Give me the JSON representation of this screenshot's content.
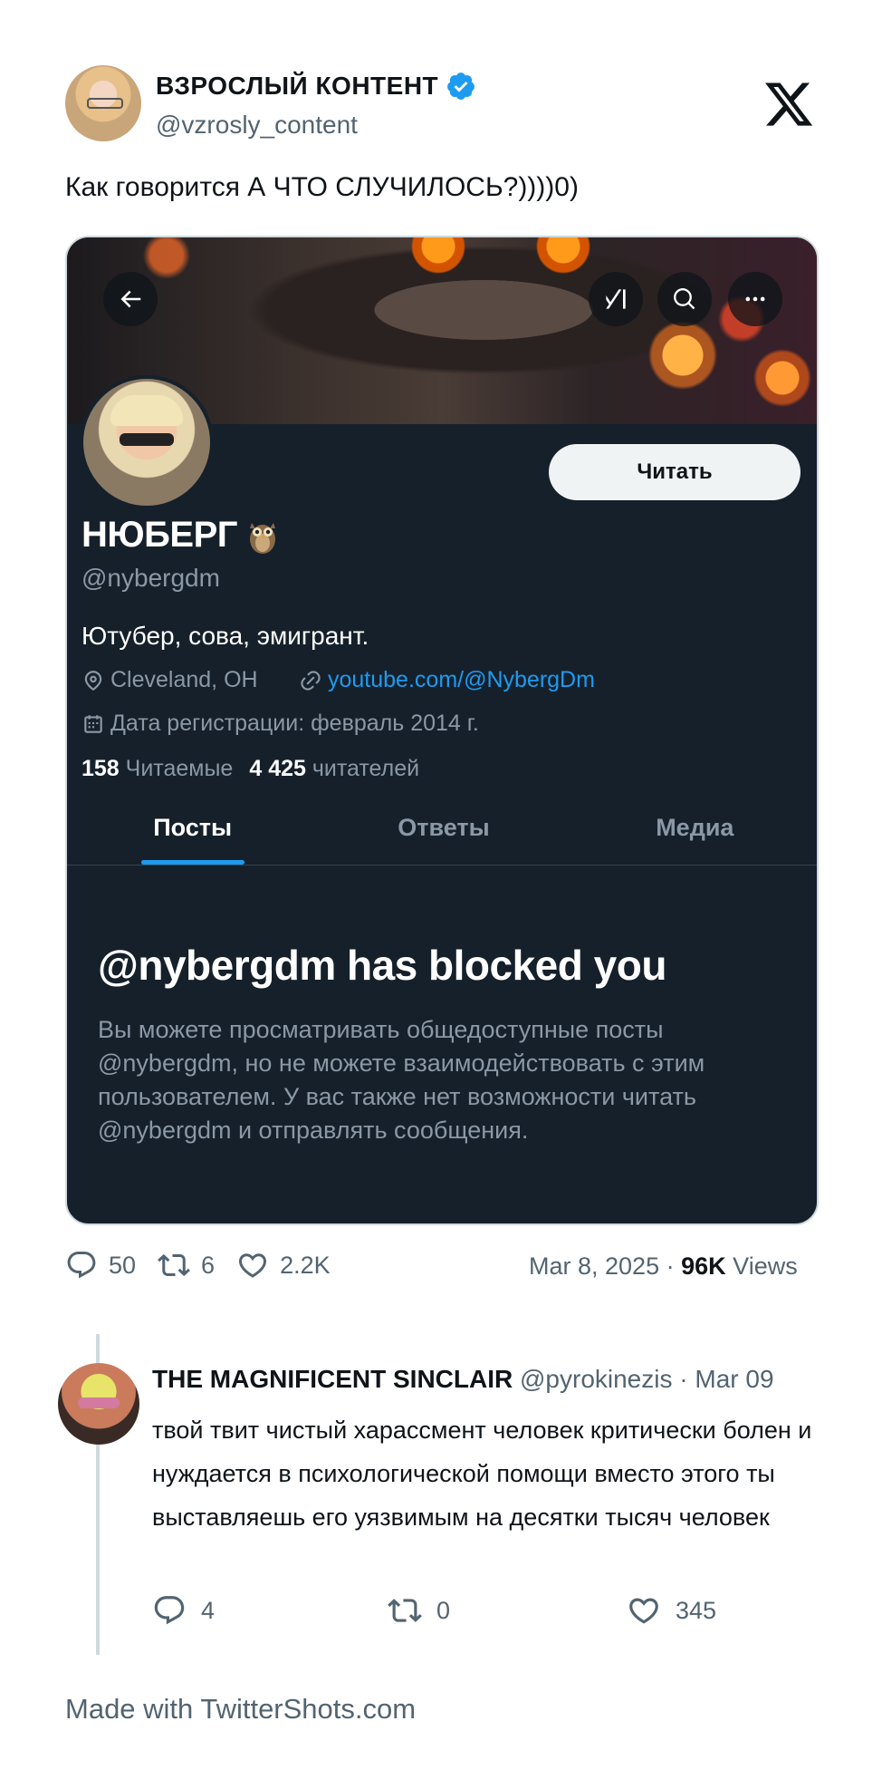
{
  "author": {
    "name": "ВЗРОСЛЫЙ КОНТЕНТ",
    "handle": "@vzrosly_content",
    "verified": true
  },
  "tweet": {
    "text": "Как говорится А ЧТО СЛУЧИЛОСЬ?))))0)",
    "replies": "50",
    "retweets": "6",
    "likes": "2.2K",
    "date": "Mar 8, 2025",
    "separator": "·",
    "views_count": "96K",
    "views_label": "Views"
  },
  "embedded_profile": {
    "follow_button": "Читать",
    "name": "НЮБЕРГ",
    "handle": "@nybergdm",
    "bio": "Ютубер, сова, эмигрант.",
    "location": "Cleveland, OH",
    "link": "youtube.com/@NybergDm",
    "joined": "Дата регистрации: февраль 2014 г.",
    "following_count": "158",
    "following_label": "Читаемые",
    "followers_count": "4 425",
    "followers_label": "читателей",
    "tabs": [
      {
        "label": "Посты",
        "active": true
      },
      {
        "label": "Ответы",
        "active": false
      },
      {
        "label": "Медиа",
        "active": false
      }
    ],
    "blocked_title": "@nybergdm has blocked you",
    "blocked_body": "Вы можете просматривать общедоступные посты @nybergdm, но не можете взаимодействовать с этим пользователем. У вас также нет возможности читать @nybergdm и отправлять сообщения."
  },
  "reply": {
    "name": "THE MAGNIFICENT SINCLAIR",
    "handle": "@pyrokinezis",
    "separator": "·",
    "date": "Mar 09",
    "text": "твой твит чистый харассмент человек критически болен и нуждается в психологической помощи вместо этого ты выставляешь его уязвимым на десятки тысяч человек",
    "replies": "4",
    "retweets": "0",
    "likes": "345"
  },
  "footer": "Made with TwitterShots.com",
  "colors": {
    "accent": "#1d9bf0",
    "card_bg": "#15202b",
    "muted": "#536471"
  }
}
